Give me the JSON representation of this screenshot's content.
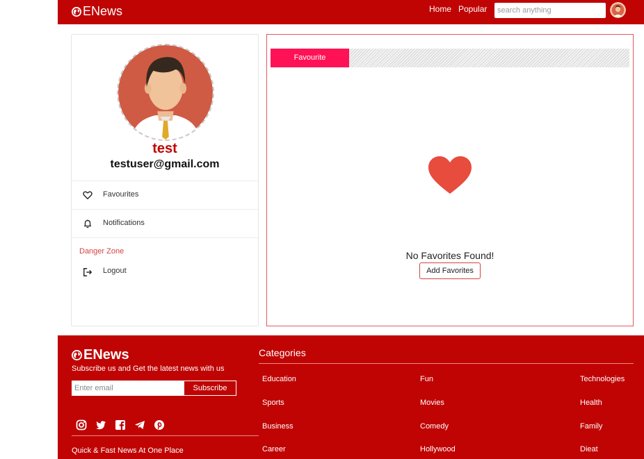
{
  "header": {
    "brand": "ENews",
    "nav": {
      "home": "Home",
      "popular": "Popular"
    },
    "search_placeholder": "search anything"
  },
  "profile": {
    "name": "test",
    "email": "testuser@gmail.com",
    "menu": [
      {
        "label": "Favourites",
        "icon": "heart-outline-icon"
      },
      {
        "label": "Notifications",
        "icon": "bell-icon"
      }
    ],
    "danger_zone": "Danger Zone",
    "logout": "Logout"
  },
  "favourites": {
    "tab": "Favourite",
    "empty_text": "No Favorites Found!",
    "add_button": "Add Favorites",
    "heart_color": "#e74c3c"
  },
  "footer": {
    "brand": "ENews",
    "subtitle": "Subscribe us and Get the latest news with us",
    "email_placeholder": "Enter email",
    "subscribe": "Subscribe",
    "social_icons": [
      "instagram-icon",
      "twitter-icon",
      "facebook-icon",
      "telegram-icon",
      "pinterest-icon"
    ],
    "tagline": "Quick & Fast News At One Place",
    "categories_title": "Categories",
    "categories": [
      [
        "Education",
        "Fun",
        "Technologies"
      ],
      [
        "Sports",
        "Movies",
        "Health"
      ],
      [
        "Business",
        "Comedy",
        "Family"
      ],
      [
        "Career",
        "Hollywood",
        "Dieat"
      ]
    ]
  },
  "colors": {
    "brand_red": "#c00404",
    "tab_pink": "#ff1156",
    "danger": "#d64141"
  }
}
